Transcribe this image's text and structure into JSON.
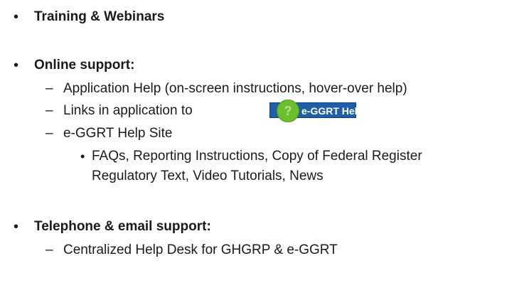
{
  "sections": [
    {
      "heading": "Training & Webinars"
    },
    {
      "heading": "Online support:",
      "items": [
        "Application Help (on-screen instructions, hover-over help)",
        "Links in application to",
        "e-GGRT Help Site"
      ],
      "sub_items": [
        "FAQs, Reporting Instructions, Copy of Federal Register",
        "Regulatory Text, Video Tutorials, News"
      ]
    },
    {
      "heading": "Telephone & email support:",
      "items": [
        "Centralized Help Desk for GHGRP & e-GGRT"
      ]
    }
  ],
  "help_button": {
    "label": "e-GGRT Help",
    "icon": "question-icon",
    "symbol": "?"
  },
  "glyphs": {
    "bullet": "•",
    "dash": "–",
    "sub_bullet": "•"
  }
}
